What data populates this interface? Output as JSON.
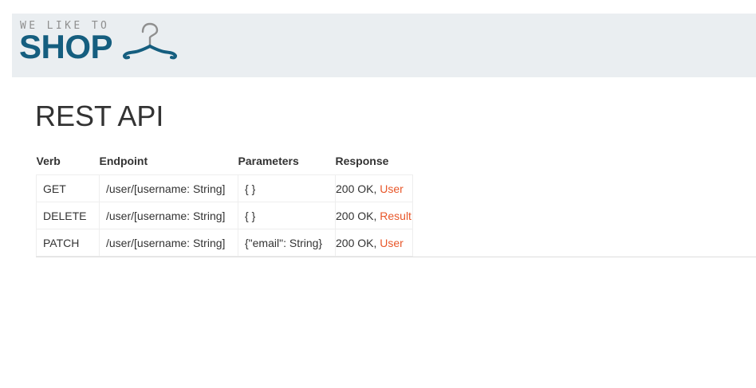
{
  "header": {
    "logo_tagline": "WE LIKE TO",
    "logo_word": "SHOP",
    "hanger_icon": "hanger-icon",
    "brand_color": "#155e7f",
    "background": "#eaeef1"
  },
  "page": {
    "title": "REST API"
  },
  "table": {
    "columns": [
      "Verb",
      "Endpoint",
      "Parameters",
      "Response"
    ],
    "rows": [
      {
        "verb": "GET",
        "endpoint": "/user/[username: String]",
        "parameters": "{ }",
        "status": "200 OK, ",
        "response_link": "User"
      },
      {
        "verb": "DELETE",
        "endpoint": "/user/[username: String]",
        "parameters": "{ }",
        "status": "200 OK, ",
        "response_link": "Result"
      },
      {
        "verb": "PATCH",
        "endpoint": "/user/[username: String]",
        "parameters": "{\"email\": String}",
        "status": "200 OK, ",
        "response_link": "User"
      }
    ]
  },
  "colors": {
    "link": "#e8572a",
    "text": "#333333"
  }
}
